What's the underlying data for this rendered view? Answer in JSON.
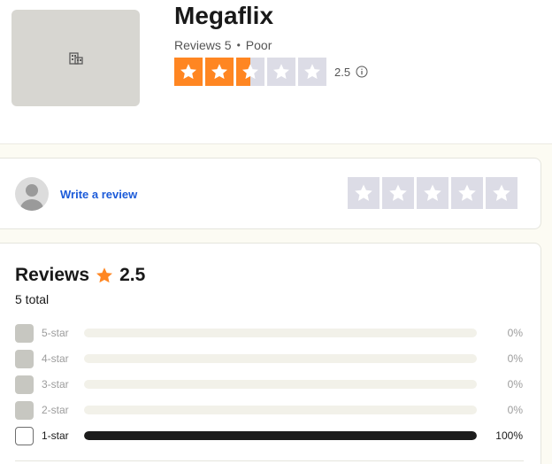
{
  "company": {
    "name": "Megaflix",
    "reviews_label": "Reviews 5",
    "separator": "•",
    "rating_text": "Poor",
    "rating_value": "2.5",
    "rating_fraction": 0.5
  },
  "write_review": {
    "link_label": "Write a review",
    "stars_filled": 0
  },
  "reviews": {
    "title": "Reviews",
    "score": "2.5",
    "total": "5 total",
    "distribution": [
      {
        "label": "5-star",
        "percent_text": "0%",
        "percent": 0,
        "checked_style": false
      },
      {
        "label": "4-star",
        "percent_text": "0%",
        "percent": 0,
        "checked_style": false
      },
      {
        "label": "3-star",
        "percent_text": "0%",
        "percent": 0,
        "checked_style": false
      },
      {
        "label": "2-star",
        "percent_text": "0%",
        "percent": 0,
        "checked_style": false
      },
      {
        "label": "1-star",
        "percent_text": "100%",
        "percent": 100,
        "checked_style": true
      }
    ]
  },
  "colors": {
    "star_fill": "#ff8622",
    "star_empty": "#dcdce6",
    "link": "#1c5bd9",
    "bar_fill": "#1c1c1c"
  },
  "icons": {
    "logo": "building-icon",
    "info": "info-icon",
    "avatar": "avatar-icon",
    "star": "star-icon"
  }
}
